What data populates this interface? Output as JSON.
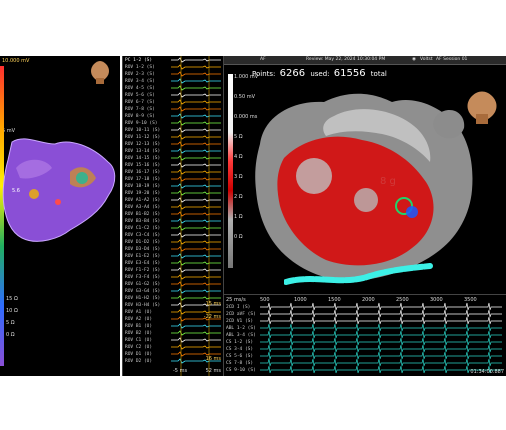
{
  "left_panel": {
    "top_label": "10.000 mV",
    "mid_label": "5 mV",
    "scale": [
      "15 Ω",
      "10 Ω",
      "5 Ω",
      "0 Ω"
    ]
  },
  "mid_panel": {
    "rows": [
      "PC 1-2 (S)",
      "ROV 1-2 (S)",
      "ROV 2-3 (S)",
      "ROV 3-4 (S)",
      "ROV 4-5 (S)",
      "ROV 5-6 (S)",
      "ROV 6-7 (S)",
      "ROV 7-8 (S)",
      "ROV 8-9 (S)",
      "ROV 9-10 (S)",
      "ROV 10-11 (S)",
      "ROV 11-12 (S)",
      "ROV 12-13 (S)",
      "ROV 13-14 (S)",
      "ROV 14-15 (S)",
      "ROV 15-16 (S)",
      "ROV 16-17 (S)",
      "ROV 17-18 (S)",
      "ROV 18-19 (S)",
      "ROV 19-20 (S)",
      "ROV A1-A2 (S)",
      "ROV A3-A4 (S)",
      "ROV B1-B2 (S)",
      "ROV B3-B4 (S)",
      "ROV C1-C2 (S)",
      "ROV C3-C4 (S)",
      "ROV D1-D2 (S)",
      "ROV D3-D4 (S)",
      "ROV E1-E2 (S)",
      "ROV E3-E4 (S)",
      "ROV F1-F2 (S)",
      "ROV F3-F4 (S)",
      "ROV G1-G2 (S)",
      "ROV G3-G4 (S)",
      "ROV H1-H2 (S)",
      "ROV H3-H4 (S)",
      "ROV A1 (U)",
      "ROV A2 (U)",
      "ROV B1 (U)",
      "ROV B2 (U)",
      "ROV C1 (U)",
      "ROV C2 (U)",
      "ROV D1 (U)",
      "ROV D2 (U)"
    ],
    "footer": [
      "-5 ms",
      "52 ms"
    ],
    "side_notes": [
      "15 ms",
      "-22 ms",
      "16 ms"
    ]
  },
  "right_panel": {
    "header": {
      "left": "AF",
      "center": "Review: May 22, 2024 10:30:04 PM",
      "right_icon": "voice-icon",
      "right_label": "Voltst",
      "session": "AF Session 01"
    },
    "points": {
      "label": "Points:",
      "value": "6266",
      "used_label": "used:",
      "used_value": "61556",
      "total_label": "total"
    },
    "colorbar_labels": [
      "1.000 mV",
      "0.50 mV",
      "0.000 ms",
      "5 Ω",
      "4 Ω",
      "3 Ω",
      "2 Ω",
      "1 Ω",
      "0 Ω"
    ],
    "contact_force": "8 g",
    "ecg": {
      "scale_label": "25 ms/s",
      "time_ticks": [
        "500",
        "1000",
        "1500",
        "2000",
        "2500",
        "3000",
        "3500"
      ],
      "leads": [
        "2CD I (S)",
        "2CD aVF (S)",
        "2CD V1 (S)",
        "ABL 1-2 (S)",
        "ABL 3-4 (S)",
        "CS 1-2 (S)",
        "CS 3-4 (S)",
        "CS 5-6 (S)",
        "CS 7-8 (S)",
        "CS 9-10 (S)"
      ],
      "time_readout": "01:34:00.887"
    }
  },
  "colors": {
    "map_purple": "#8a4fd6",
    "map_red": "#d01818",
    "accent_cyan": "#3cf0e6",
    "ecg_cyan": "#2bd6c8"
  }
}
